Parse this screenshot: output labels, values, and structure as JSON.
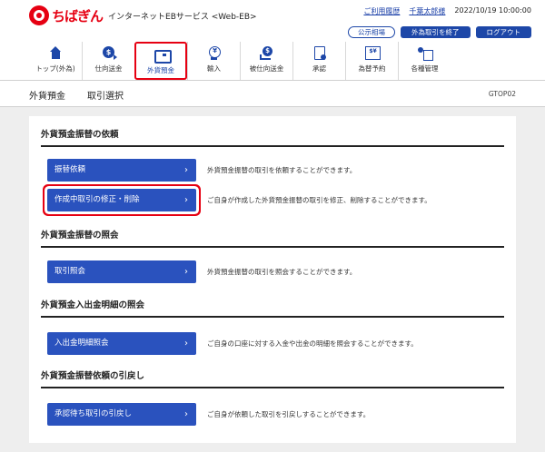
{
  "header": {
    "logo_text": "ちばぎん",
    "service_name": "インターネットEBサービス <Web-EB>",
    "usage_history_link": "ご利用履歴",
    "user_name": "千葉太郎様",
    "datetime": "2022/10/19 10:00:00",
    "rate_button": "公示相場",
    "end_fx_button": "外為取引を終了",
    "logout_button": "ログアウト"
  },
  "nav": {
    "items": [
      {
        "label": "トップ(外為)",
        "icon": "home-icon"
      },
      {
        "label": "仕向送金",
        "icon": "remittance-icon"
      },
      {
        "label": "外貨預金",
        "icon": "wallet-icon",
        "selected": true
      },
      {
        "label": "輸入",
        "icon": "import-icon"
      },
      {
        "label": "被仕向送金",
        "icon": "incoming-remittance-icon"
      },
      {
        "label": "承認",
        "icon": "approval-icon"
      },
      {
        "label": "為替予約",
        "icon": "exchange-reservation-icon"
      },
      {
        "label": "各種管理",
        "icon": "management-icon"
      }
    ]
  },
  "title_bar": {
    "main": "外貨預金",
    "sub": "取引選択",
    "screen_id": "GTOP02"
  },
  "sections": [
    {
      "title": "外貨預金振替の依頼",
      "actions": [
        {
          "label": "振替依頼",
          "desc": "外貨預金振替の取引を依頼することができます。"
        },
        {
          "label": "作成中取引の修正・削除",
          "desc": "ご自身が作成した外貨預金振替の取引を修正、削除することができます。",
          "highlight": true
        }
      ]
    },
    {
      "title": "外貨預金振替の照会",
      "actions": [
        {
          "label": "取引照会",
          "desc": "外貨預金振替の取引を照会することができます。"
        }
      ]
    },
    {
      "title": "外貨預金入出金明細の照会",
      "actions": [
        {
          "label": "入出金明細照会",
          "desc": "ご自身の口座に対する入金や出金の明細を照会することができます。"
        }
      ]
    },
    {
      "title": "外貨預金振替依頼の引戻し",
      "actions": [
        {
          "label": "承認待ち取引の引戻し",
          "desc": "ご自身が依頼した取引を引戻しすることができます。"
        }
      ]
    }
  ],
  "chevron": "›"
}
